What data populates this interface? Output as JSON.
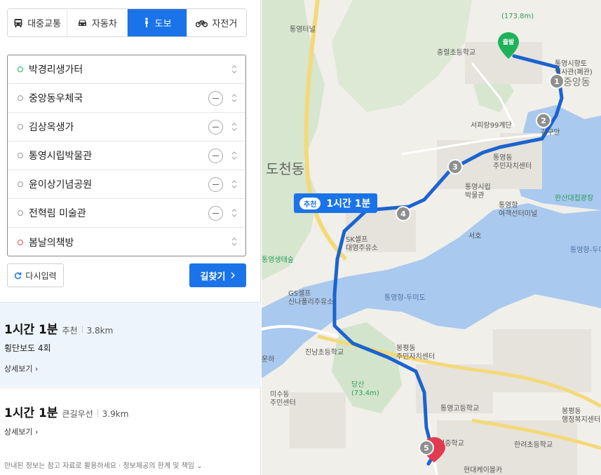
{
  "modes": [
    {
      "label": "대중교통",
      "icon": "bus-icon"
    },
    {
      "label": "자동차",
      "icon": "car-icon"
    },
    {
      "label": "도보",
      "icon": "walk-icon",
      "active": true
    },
    {
      "label": "자전거",
      "icon": "bicycle-icon"
    }
  ],
  "stops": [
    "박경리생가터",
    "중앙동우체국",
    "김상옥생가",
    "통영시립박물관",
    "윤이상기념공원",
    "전혁림 미술관",
    "봄날의책방"
  ],
  "actions": {
    "reset_label": "다시입력",
    "search_label": "길찾기"
  },
  "routes": [
    {
      "time": "1시간 1분",
      "tag": "추천",
      "distance": "3.8km",
      "detail": "횡단보도 4회",
      "more": "상세보기"
    },
    {
      "time": "1시간 1분",
      "tag": "큰길우선",
      "distance": "3.9km",
      "more": "상세보기"
    }
  ],
  "footer": "안내된 정보는 참고 자료로 활용하세요 · 정보제공의 한계 및 책임",
  "map": {
    "badge_tag": "추천",
    "badge_time": "1시간 1분",
    "start_label": "출발",
    "waypoints": [
      "1",
      "2",
      "3",
      "4",
      "5"
    ],
    "labels": {
      "tunnel": "통영터널",
      "school1": "충렬초등학교",
      "stairs": "서피랑99계단",
      "gangguan": "강구안",
      "docheon": "도천동",
      "museum": "통영시립\n박물관",
      "community1": "통영동\n주민자치센터",
      "terminal": "통영항\n여객선터미널",
      "seoho": "서호",
      "hansan": "한산대첩광장",
      "sk": "SK셀프\n대영주유소",
      "tennis": "통영생태숲",
      "gs": "GS셀프\n신나폴리주유소",
      "bay": "통영항-두미도",
      "bay2": "통영항-두미도",
      "jinnam": "진남초등학교",
      "bongpyeong": "봉평동\n주민자치센터",
      "dangsan": "당산\n(73.4m)",
      "misu": "미수동\n주민센터",
      "tyhigh": "통영고등학교",
      "hanryeo": "한려초등학교",
      "ymiddle": "영중학교",
      "bongpyeong2": "봉평동\n행정복지센터",
      "cable": "현대케이블카",
      "unha": "운하",
      "top": "(173.8m)",
      "jungang": "중앙동",
      "sigyeong": "통영시향토\n역사관(폐관)"
    }
  }
}
